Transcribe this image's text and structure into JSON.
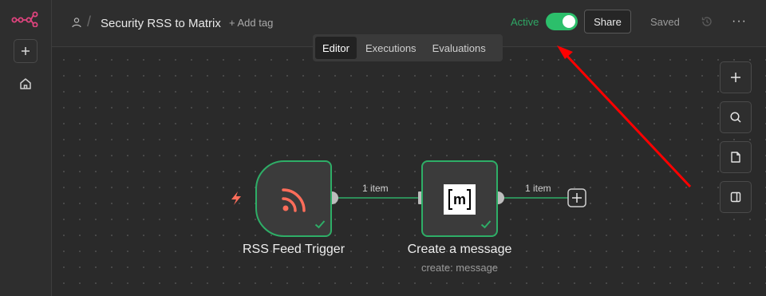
{
  "header": {
    "workflow_title": "Security RSS to Matrix",
    "add_tag_label": "+ Add tag",
    "active_label": "Active",
    "active": true,
    "share_label": "Share",
    "saved_label": "Saved",
    "more_label": "···"
  },
  "tabs": [
    {
      "label": "Editor",
      "selected": true
    },
    {
      "label": "Executions",
      "selected": false
    },
    {
      "label": "Evaluations",
      "selected": false
    }
  ],
  "nodes": [
    {
      "name": "RSS Feed Trigger",
      "subtitle": "",
      "status": "success",
      "icon": "rss-icon"
    },
    {
      "name": "Create a message",
      "subtitle": "create: message",
      "status": "success",
      "icon": "matrix-logo"
    }
  ],
  "matrix_logo_text": "m",
  "connections": [
    {
      "label": "1 item"
    },
    {
      "label": "1 item"
    }
  ],
  "colors": {
    "accent_green": "#2eae67",
    "toggle_green": "#2cbf6b",
    "brand_pink": "#e0447e",
    "rss_orange": "#ff6d5a",
    "annotation_red": "#ff0000"
  },
  "icons": {
    "rail": [
      "n8n-logo-icon",
      "plus-icon",
      "home-icon"
    ],
    "toolbar": [
      "plus-icon",
      "search-icon",
      "sticky-note-icon",
      "panel-toggle-icon"
    ],
    "trigger": "lightning-icon"
  }
}
